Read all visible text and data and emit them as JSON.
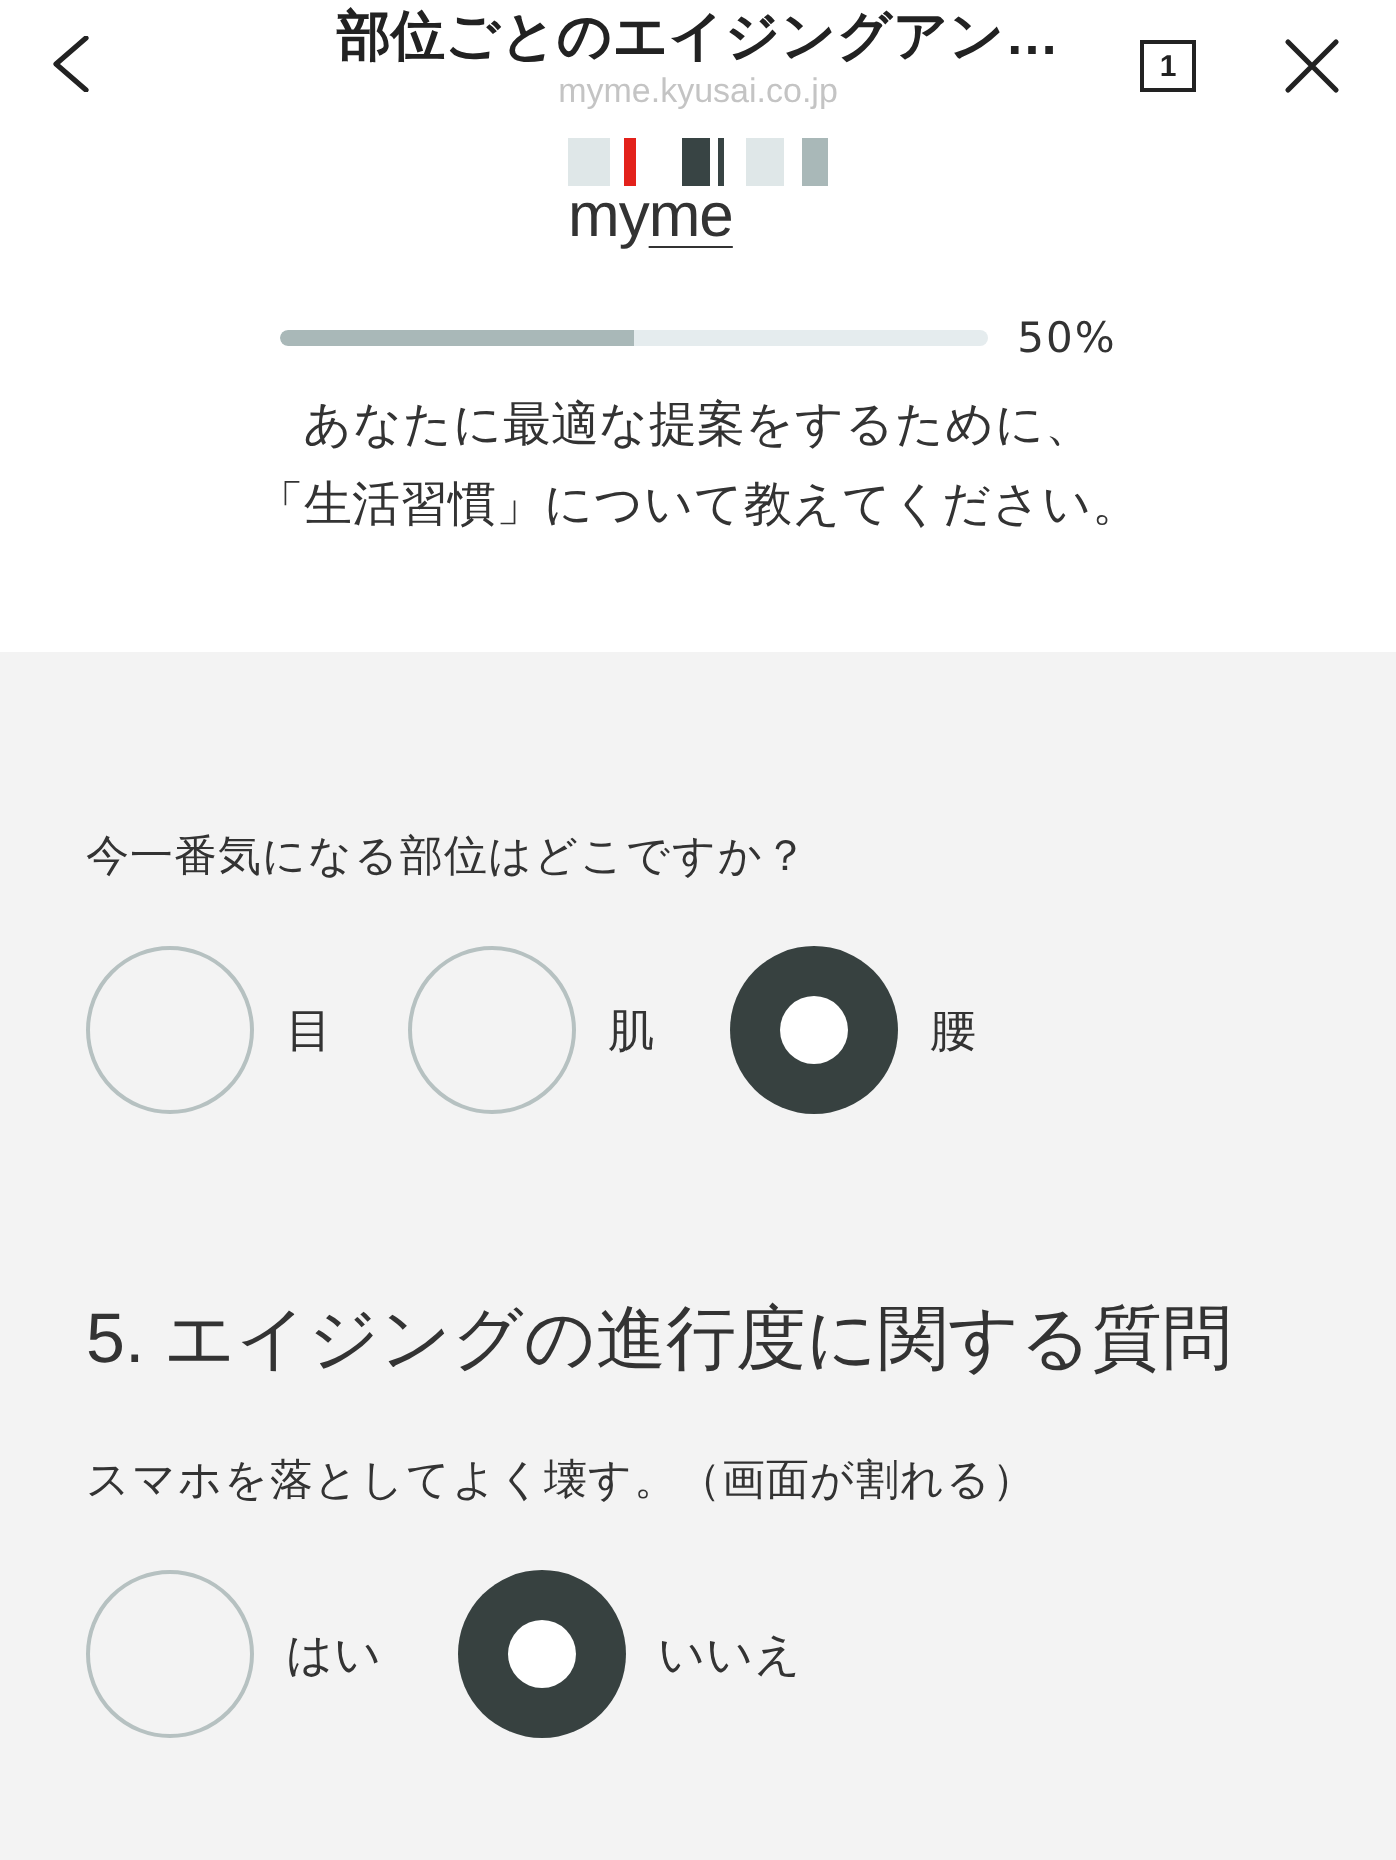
{
  "header": {
    "title": "部位ごとのエイジングアン…",
    "url": "myme.kyusai.co.jp",
    "tab_count": "1"
  },
  "logo": {
    "text": "myme"
  },
  "progress": {
    "level": 0.5,
    "reading": "50%"
  },
  "intro_lines": [
    "あなたに最適な提案をするために、",
    "「生活習慣」について教えてください。"
  ],
  "sections": [
    {
      "questions": [
        {
          "text": "今一番気になる部位はどこですか？",
          "options": [
            {
              "label": "目",
              "selected": false
            },
            {
              "label": "肌",
              "selected": false
            },
            {
              "label": "腰",
              "selected": true
            }
          ]
        }
      ]
    },
    {
      "heading": "5. エイジングの進行度に関する質問",
      "questions": [
        {
          "text": "スマホを落としてよく壊す。（画面が割れる）",
          "options": [
            {
              "label": "はい",
              "selected": false
            },
            {
              "label": "いいえ",
              "selected": true
            }
          ]
        }
      ]
    }
  ]
}
